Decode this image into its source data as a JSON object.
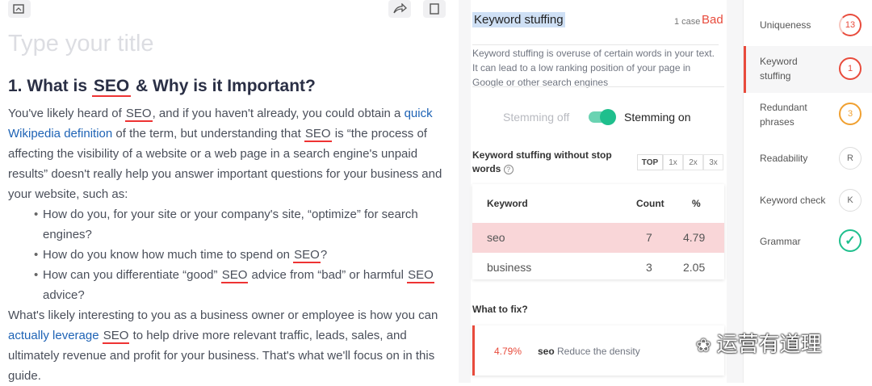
{
  "editor": {
    "title_placeholder": "Type your title",
    "heading_num": "1. What is ",
    "heading_kw": "SEO",
    "heading_rest": " & Why is it Important?",
    "p1_a": "You've likely heard of ",
    "p1_kw1": "SEO",
    "p1_b": ", and if you haven't already, you could obtain a ",
    "p1_link": "quick Wikipedia definition",
    "p1_c": " of the term, but understanding that ",
    "p1_kw2": "SEO",
    "p1_d": " is “the process of affecting the visibility of a website or a web page in a search engine's unpaid results” doesn't really help you answer important questions for your business and your website, such as:",
    "b1": "How do you, for your site or your company's site, “optimize” for search",
    "b1_cont": "engines?",
    "b2_a": "How do you know how much time to spend on ",
    "b2_kw": "SEO",
    "b2_b": "?",
    "b3_a": "How can you differentiate “good” ",
    "b3_kw1": "SEO",
    "b3_b": " advice from “bad” or harmful ",
    "b3_kw2": "SEO",
    "b3_cont": "advice?",
    "p2_a": "What's likely interesting to you as a business owner or employee is how you can ",
    "p2_link": "actually leverage",
    "p2_kw": "SEO",
    "p2_b": " to help drive more relevant traffic, leads, sales, and ultimately revenue and profit for your business. That's what we'll focus on in this guide."
  },
  "panel": {
    "section_title": "Keyword stuffing",
    "case_count": "1 case",
    "status": "Bad",
    "status_color": "#e84b3c",
    "description": "Keyword stuffing is overuse of certain words in your text. It can lead to a low ranking position of your page in Google or other search engines",
    "stemming_off": "Stemming off",
    "stemming_on": "Stemming on",
    "table_title": "Keyword stuffing without stop words",
    "help_icon": "?",
    "tabs": [
      "TOP",
      "1x",
      "2x",
      "3x"
    ],
    "columns": {
      "keyword": "Keyword",
      "count": "Count",
      "pct": "%"
    },
    "rows": [
      {
        "keyword": "seo",
        "count": "7",
        "pct": "4.79"
      },
      {
        "keyword": "business",
        "count": "3",
        "pct": "2.05"
      }
    ],
    "fix_title": "What to fix?",
    "fix": {
      "pct": "4.79%",
      "kw": "seo",
      "dash": "-",
      "text": "Reduce the density"
    }
  },
  "sidebar": {
    "items": [
      {
        "label": "Uniqueness",
        "badge": "13",
        "color": "#e84b3c"
      },
      {
        "label": "Keyword stuffing",
        "badge": "1",
        "color": "#e84b3c"
      },
      {
        "label": "Redundant phrases",
        "badge": "3",
        "color": "#f0a030"
      },
      {
        "label": "Readability",
        "badge": "R",
        "color": "#999999"
      },
      {
        "label": "Keyword check",
        "badge": "K",
        "color": "#999999"
      },
      {
        "label": "Grammar",
        "badge": "✓",
        "color": "#1fbf8d"
      }
    ]
  },
  "watermark": "运营有道理"
}
